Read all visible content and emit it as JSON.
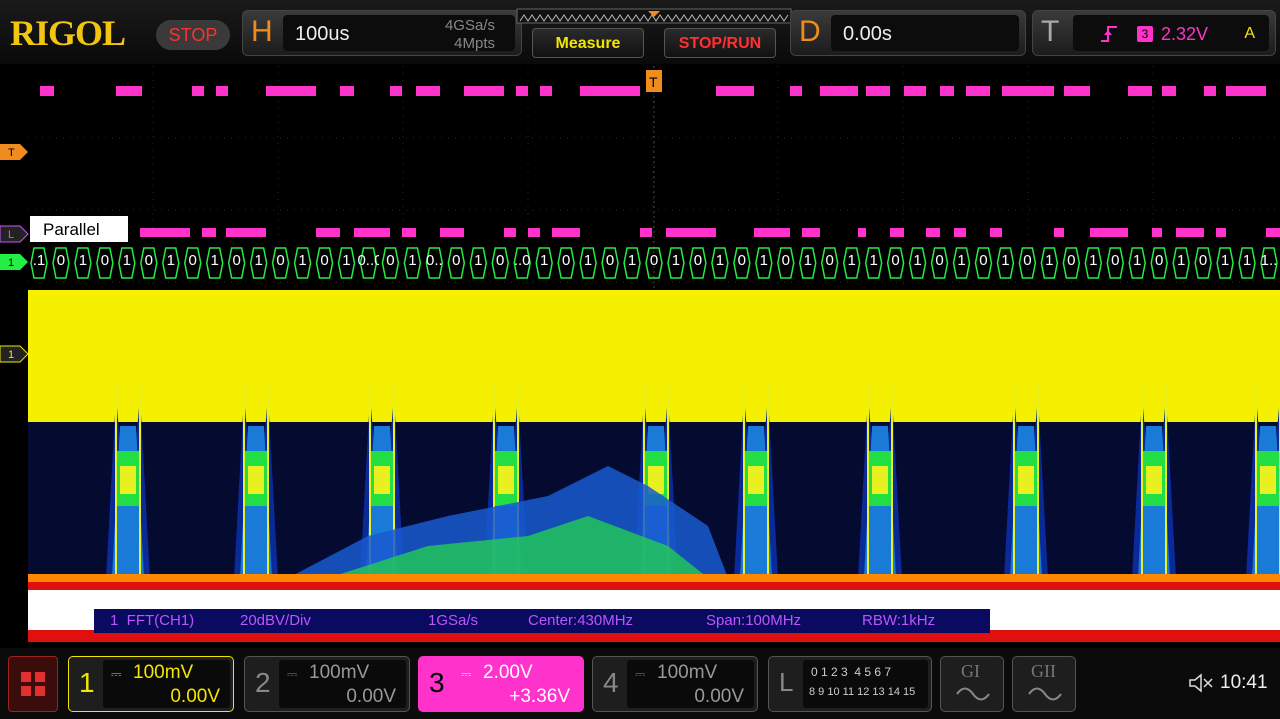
{
  "brand": "RIGOL",
  "run_state": "STOP",
  "horizontal": {
    "key": "H",
    "timebase": "100us",
    "sample_rate": "4GSa/s",
    "memory_depth": "4Mpts"
  },
  "buttons": {
    "measure": "Measure",
    "stop_run": "STOP/RUN"
  },
  "delay": {
    "key": "D",
    "value": "0.00s"
  },
  "trigger": {
    "key": "T",
    "source": "3",
    "level": "2.32V",
    "mode": "A"
  },
  "markers": {
    "trigger": "T",
    "parallel": "L",
    "digital": "1",
    "channel1": "1"
  },
  "bus": {
    "label": "Parallel",
    "values": [
      ".1",
      "0",
      "1",
      "0",
      "1",
      "0",
      "1",
      "0",
      "1",
      "0",
      "1",
      "0",
      "1",
      "0",
      "1",
      "0..0..",
      "0",
      "1",
      "0..",
      "0",
      "1",
      "0",
      "..0",
      "1",
      "0",
      "1",
      "0",
      "1",
      "0",
      "1",
      "0",
      "1",
      "0",
      "1",
      "0",
      "1",
      "0",
      "1",
      "1",
      "0",
      "1",
      "0",
      "1",
      "0",
      "1",
      "0",
      "1",
      "0",
      "1",
      "0",
      "1",
      "0",
      "1",
      "0",
      "1",
      "1",
      "1.."
    ]
  },
  "fft_bar": {
    "source": "1  FFT(CH1)",
    "scale": "20dBV/Div",
    "rate": "1GSa/s",
    "center": "Center:430MHz",
    "span": "Span:100MHz",
    "rbw": "RBW:1kHz"
  },
  "channels": [
    {
      "num": "1",
      "coupling": "⎓",
      "scale": "100mV",
      "offset": "0.00V",
      "color": "#f2e600",
      "active": true
    },
    {
      "num": "2",
      "coupling": "⎓",
      "scale": "100mV",
      "offset": "0.00V",
      "color": "#888888",
      "active": false
    },
    {
      "num": "3",
      "coupling": "⎓",
      "scale": "2.00V",
      "offset": "+3.36V",
      "color": "#ff33cc",
      "active": true
    },
    {
      "num": "4",
      "coupling": "⎓",
      "scale": "100mV",
      "offset": "0.00V",
      "color": "#888888",
      "active": false
    }
  ],
  "logic": {
    "key": "L",
    "row1": "0 1 2 3  4 5 6 7",
    "row2": "8 9 10 11 12 13 14 15"
  },
  "generators": [
    "GI",
    "GII"
  ],
  "status": {
    "time": "10:41"
  },
  "colors": {
    "ch1": "#f2e600",
    "ch3": "#ff33cc",
    "bus": "#22ee44",
    "accent": "#f08c1e"
  }
}
